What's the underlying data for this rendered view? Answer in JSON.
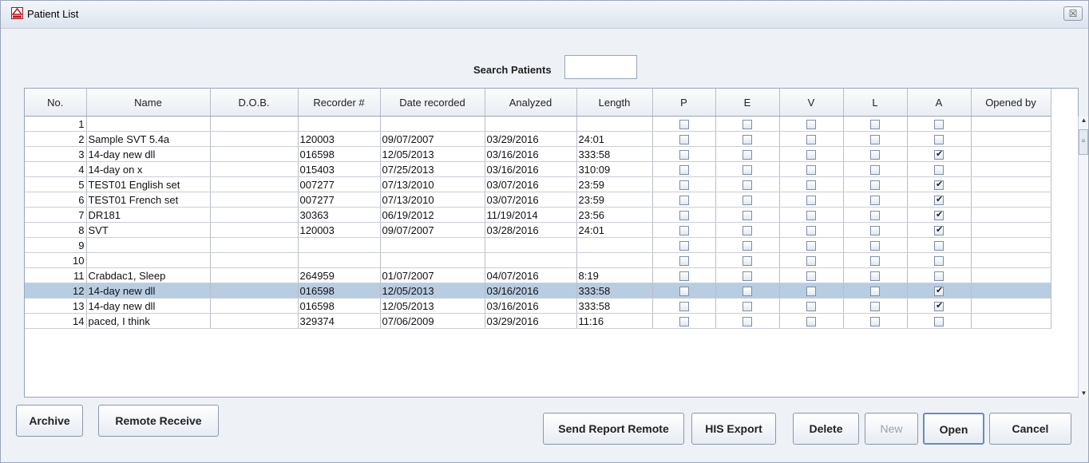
{
  "window": {
    "title": "Patient List",
    "close_label": "☒"
  },
  "search": {
    "label": "Search Patients",
    "value": ""
  },
  "table": {
    "columns": [
      "No.",
      "Name",
      "D.O.B.",
      "Recorder #",
      "Date recorded",
      "Analyzed",
      "Length",
      "P",
      "E",
      "V",
      "L",
      "A",
      "Opened by"
    ],
    "rows": [
      {
        "no": "1",
        "name": "",
        "dob": "",
        "recorder": "",
        "date_recorded": "",
        "analyzed": "",
        "length": "",
        "P": false,
        "E": false,
        "V": false,
        "L": false,
        "A": false,
        "opened_by": ""
      },
      {
        "no": "2",
        "name": "Sample SVT 5.4a",
        "dob": "",
        "recorder": "120003",
        "date_recorded": "09/07/2007",
        "analyzed": "03/29/2016",
        "length": "24:01",
        "P": false,
        "E": false,
        "V": false,
        "L": false,
        "A": false,
        "opened_by": ""
      },
      {
        "no": "3",
        "name": "14-day new dll",
        "dob": "",
        "recorder": "016598",
        "date_recorded": "12/05/2013",
        "analyzed": "03/16/2016",
        "length": "333:58",
        "P": false,
        "E": false,
        "V": false,
        "L": false,
        "A": true,
        "opened_by": ""
      },
      {
        "no": "4",
        "name": "14-day on x",
        "dob": "",
        "recorder": "015403",
        "date_recorded": "07/25/2013",
        "analyzed": "03/16/2016",
        "length": "310:09",
        "P": false,
        "E": false,
        "V": false,
        "L": false,
        "A": false,
        "opened_by": ""
      },
      {
        "no": "5",
        "name": "TEST01 English set",
        "dob": "",
        "recorder": "007277",
        "date_recorded": "07/13/2010",
        "analyzed": "03/07/2016",
        "length": "23:59",
        "P": false,
        "E": false,
        "V": false,
        "L": false,
        "A": true,
        "opened_by": ""
      },
      {
        "no": "6",
        "name": "TEST01 French set",
        "dob": "",
        "recorder": "007277",
        "date_recorded": "07/13/2010",
        "analyzed": "03/07/2016",
        "length": "23:59",
        "P": false,
        "E": false,
        "V": false,
        "L": false,
        "A": true,
        "opened_by": ""
      },
      {
        "no": "7",
        "name": "DR181",
        "dob": "",
        "recorder": "30363",
        "date_recorded": "06/19/2012",
        "analyzed": "11/19/2014",
        "length": "23:56",
        "P": false,
        "E": false,
        "V": false,
        "L": false,
        "A": true,
        "opened_by": ""
      },
      {
        "no": "8",
        "name": "SVT",
        "dob": "",
        "recorder": "120003",
        "date_recorded": "09/07/2007",
        "analyzed": "03/28/2016",
        "length": "24:01",
        "P": false,
        "E": false,
        "V": false,
        "L": false,
        "A": true,
        "opened_by": ""
      },
      {
        "no": "9",
        "name": "",
        "dob": "",
        "recorder": "",
        "date_recorded": "",
        "analyzed": "",
        "length": "",
        "P": false,
        "E": false,
        "V": false,
        "L": false,
        "A": false,
        "opened_by": ""
      },
      {
        "no": "10",
        "name": "",
        "dob": "",
        "recorder": "",
        "date_recorded": "",
        "analyzed": "",
        "length": "",
        "P": false,
        "E": false,
        "V": false,
        "L": false,
        "A": false,
        "opened_by": ""
      },
      {
        "no": "11",
        "name": "Crabdac1, Sleep",
        "dob": "",
        "recorder": "264959",
        "date_recorded": "01/07/2007",
        "analyzed": "04/07/2016",
        "length": "8:19",
        "P": false,
        "E": false,
        "V": false,
        "L": false,
        "A": false,
        "opened_by": ""
      },
      {
        "no": "12",
        "name": "14-day new dll",
        "dob": "",
        "recorder": "016598",
        "date_recorded": "12/05/2013",
        "analyzed": "03/16/2016",
        "length": "333:58",
        "P": false,
        "E": false,
        "V": false,
        "L": false,
        "A": true,
        "opened_by": "",
        "selected": true
      },
      {
        "no": "13",
        "name": "14-day new dll",
        "dob": "",
        "recorder": "016598",
        "date_recorded": "12/05/2013",
        "analyzed": "03/16/2016",
        "length": "333:58",
        "P": false,
        "E": false,
        "V": false,
        "L": false,
        "A": true,
        "opened_by": ""
      },
      {
        "no": "14",
        "name": "paced, I think",
        "dob": "",
        "recorder": "329374",
        "date_recorded": "07/06/2009",
        "analyzed": "03/29/2016",
        "length": "11:16",
        "P": false,
        "E": false,
        "V": false,
        "L": false,
        "A": false,
        "opened_by": ""
      }
    ]
  },
  "buttons": {
    "archive": "Archive",
    "remote_receive": "Remote Receive",
    "send_report_remote": "Send Report Remote",
    "his_export": "HIS Export",
    "delete": "Delete",
    "new": "New",
    "open": "Open",
    "cancel": "Cancel"
  },
  "colors": {
    "selected_row": "#b8cde1",
    "window_bg": "#eef1f6"
  }
}
